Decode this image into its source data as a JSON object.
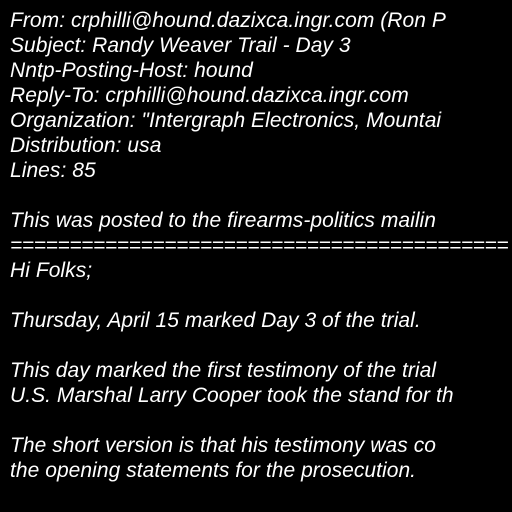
{
  "headers": {
    "from": "From: crphilli@hound.dazixca.ingr.com (Ron P",
    "subject": "Subject: Randy Weaver Trail - Day 3",
    "nntp_posting_host": "Nntp-Posting-Host: hound",
    "reply_to": "Reply-To: crphilli@hound.dazixca.ingr.com",
    "organization": "Organization: \"Intergraph Electronics, Mountai",
    "distribution": "Distribution: usa",
    "lines": "Lines: 85"
  },
  "body": {
    "preface": "This was posted to the firearms-politics mailin",
    "separator": "==========================================",
    "greeting": "Hi Folks;",
    "paragraph1": "Thursday, April 15 marked Day 3 of the trial.",
    "paragraph2_line1": "This day marked the first testimony of the trial",
    "paragraph2_line2": "U.S. Marshal Larry Cooper took the stand for th",
    "paragraph3_line1": "The short version is that his testimony was co",
    "paragraph3_line2": "the opening statements for the prosecution."
  },
  "colors": {
    "background": "#000000",
    "text": "#ffffff"
  }
}
